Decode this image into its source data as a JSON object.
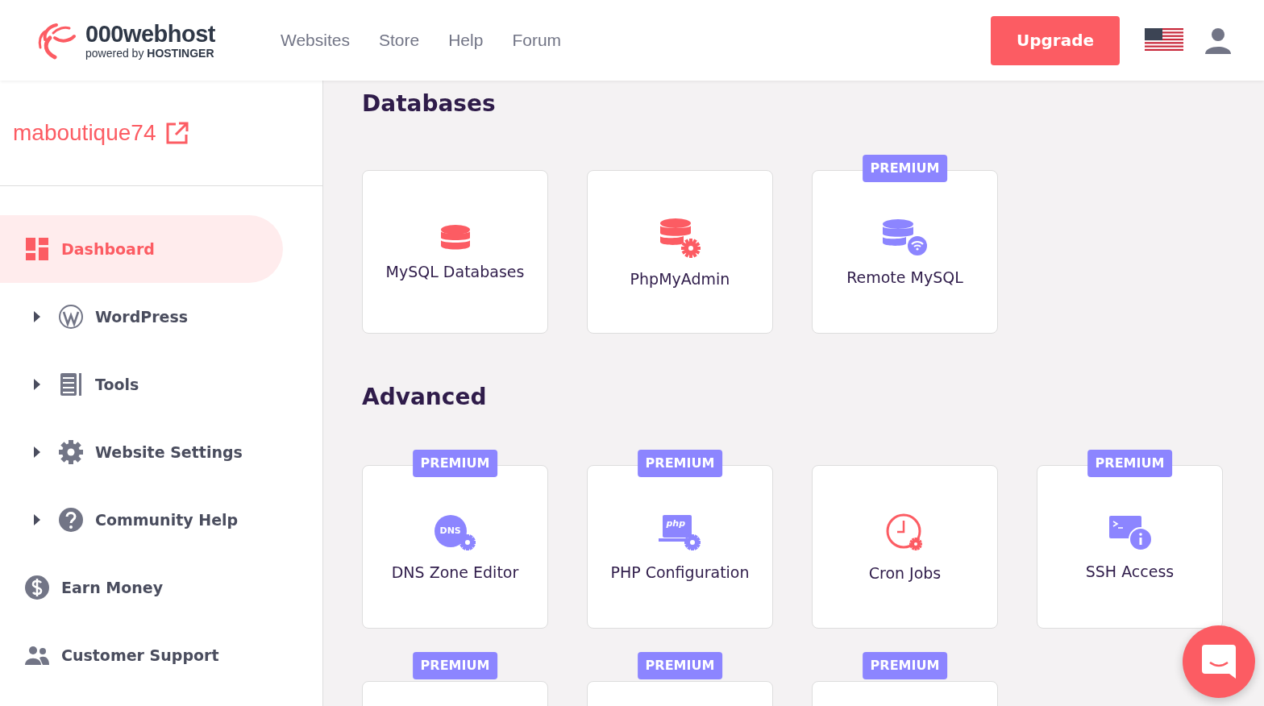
{
  "header": {
    "logo": {
      "name": "000webhost",
      "tagline_prefix": "powered by",
      "tagline_brand": "HOSTINGER"
    },
    "nav": [
      "Websites",
      "Store",
      "Help",
      "Forum"
    ],
    "upgrade": "Upgrade"
  },
  "sidebar": {
    "site_name": "maboutique74",
    "items": [
      {
        "label": "Dashboard",
        "kind": "dashboard",
        "expandable": false,
        "selected": true
      },
      {
        "label": "WordPress",
        "kind": "wordpress",
        "expandable": true,
        "selected": false
      },
      {
        "label": "Tools",
        "kind": "tools",
        "expandable": true,
        "selected": false
      },
      {
        "label": "Website Settings",
        "kind": "gear",
        "expandable": true,
        "selected": false
      },
      {
        "label": "Community Help",
        "kind": "help",
        "expandable": true,
        "selected": false
      },
      {
        "label": "Earn Money",
        "kind": "dollar",
        "expandable": false,
        "selected": false
      },
      {
        "label": "Customer Support",
        "kind": "people",
        "expandable": false,
        "selected": false
      }
    ]
  },
  "sections": [
    {
      "title": "Databases",
      "tiles": [
        {
          "label": "MySQL Databases",
          "kind": "db",
          "premium": false
        },
        {
          "label": "PhpMyAdmin",
          "kind": "dbgear",
          "premium": false
        },
        {
          "label": "Remote MySQL",
          "kind": "dbwifi",
          "premium": true,
          "badge": "PREMIUM"
        }
      ]
    },
    {
      "title": "Advanced",
      "tiles": [
        {
          "label": "DNS Zone Editor",
          "kind": "dns",
          "icon_text": "DNS",
          "premium": true,
          "badge": "PREMIUM"
        },
        {
          "label": "PHP Configuration",
          "kind": "php",
          "icon_text": "php",
          "premium": true,
          "badge": "PREMIUM"
        },
        {
          "label": "Cron Jobs",
          "kind": "clock",
          "premium": false
        },
        {
          "label": "SSH Access",
          "kind": "terminal",
          "premium": true,
          "badge": "PREMIUM"
        },
        {
          "kind": "blank",
          "premium": true,
          "badge": "PREMIUM"
        },
        {
          "kind": "blank",
          "premium": true,
          "badge": "PREMIUM"
        },
        {
          "kind": "blank",
          "premium": true,
          "badge": "PREMIUM"
        }
      ]
    }
  ]
}
